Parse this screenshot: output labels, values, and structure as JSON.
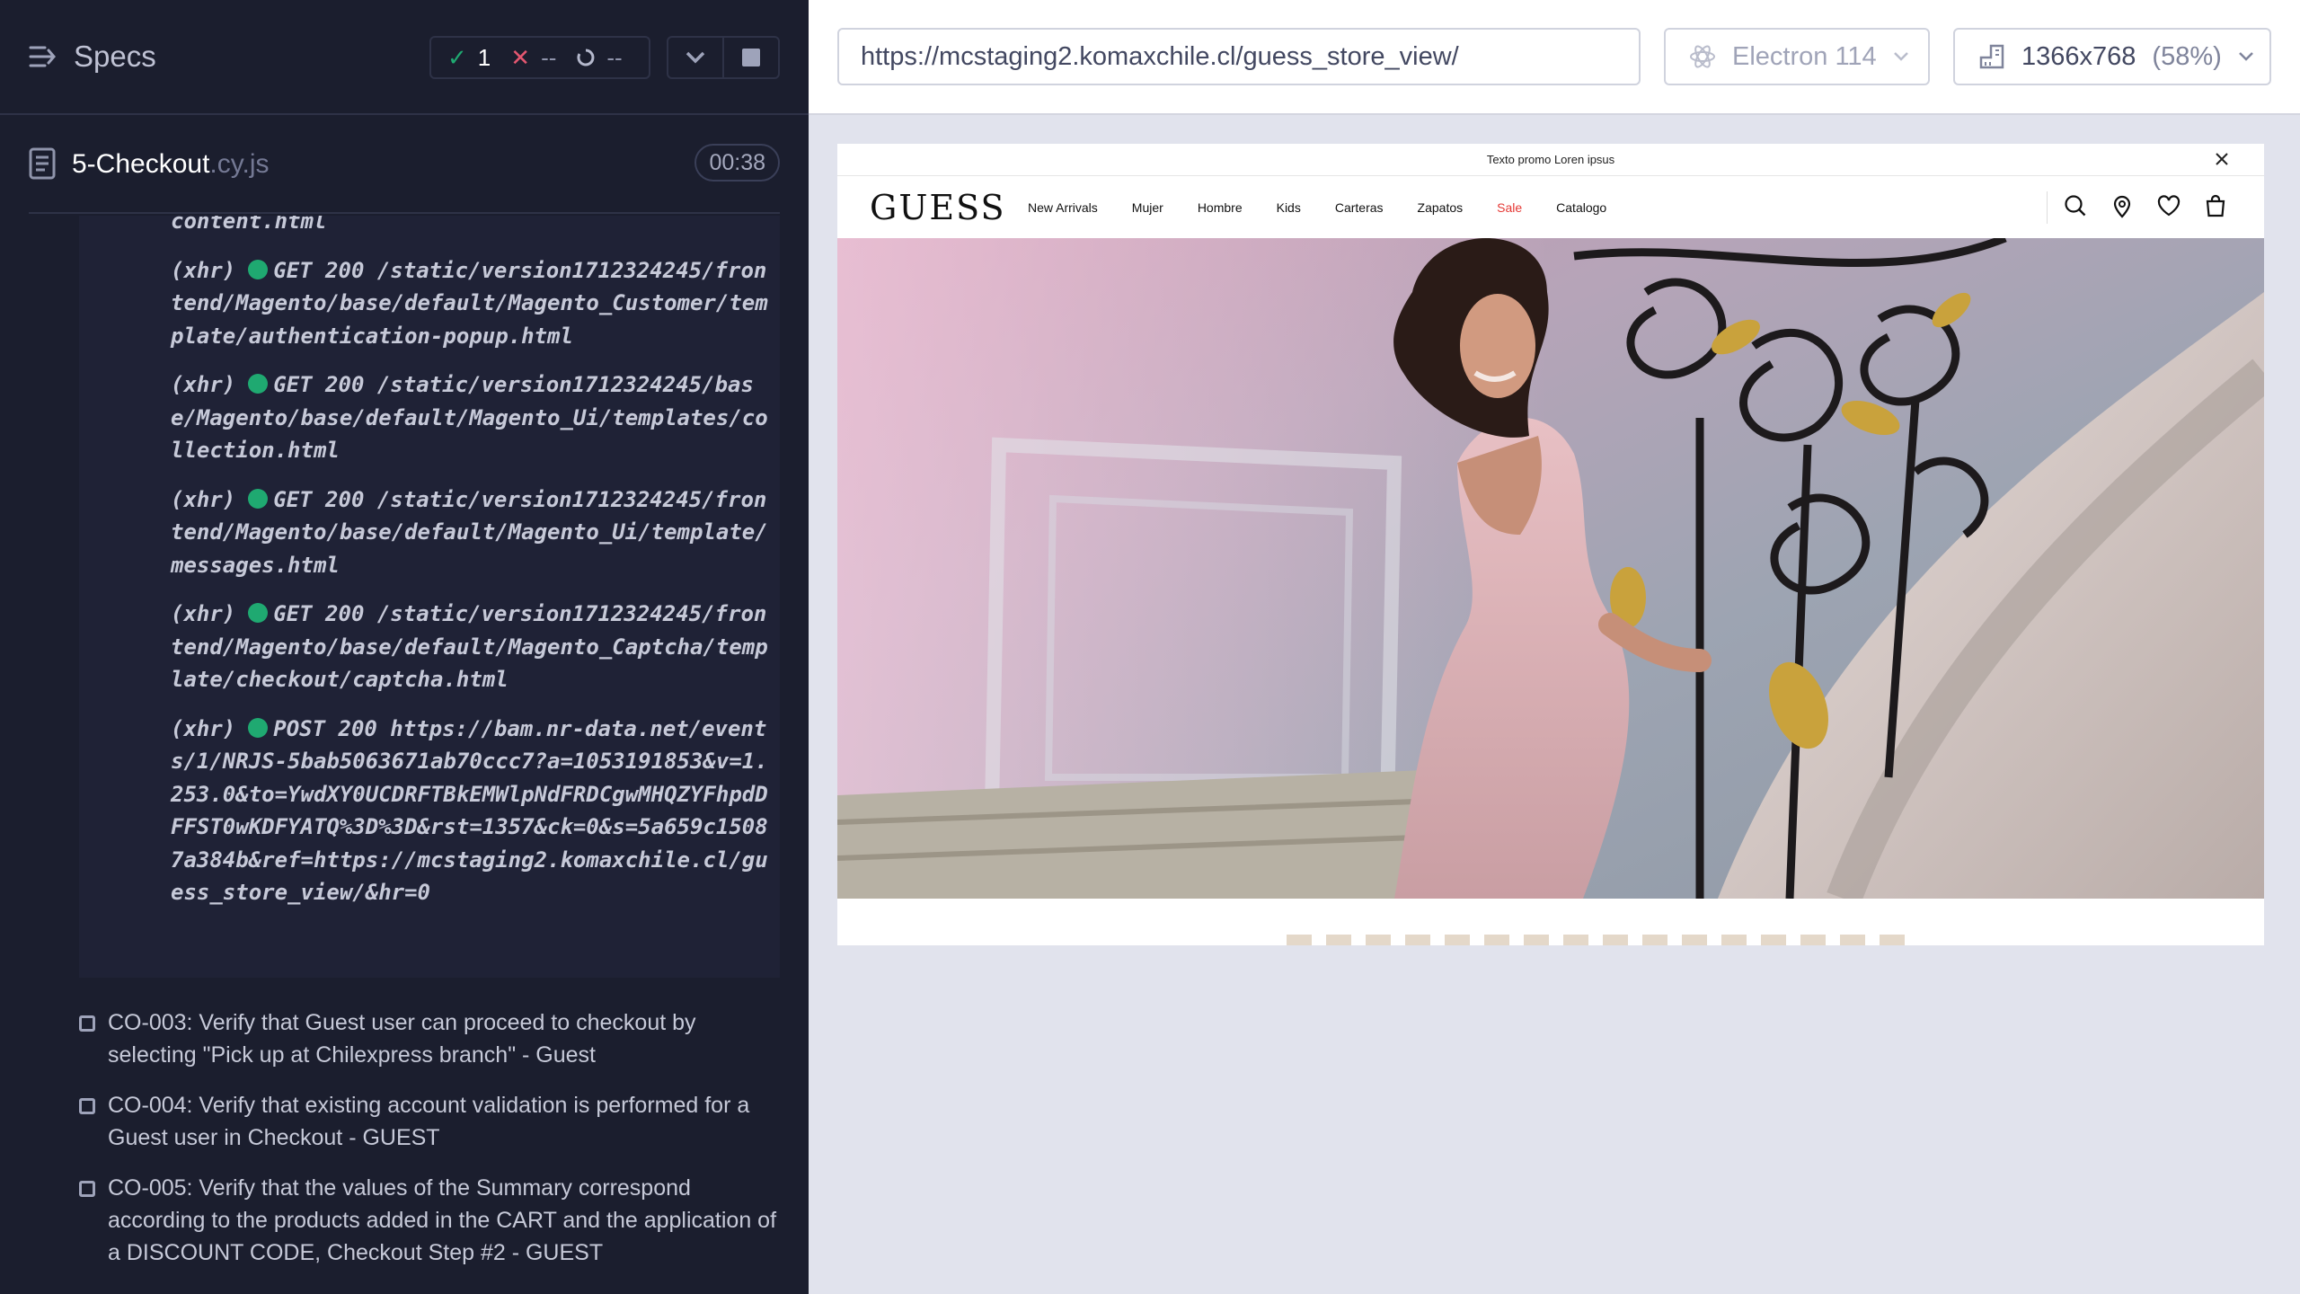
{
  "reporter": {
    "specs_label": "Specs",
    "stats": {
      "passed": "1",
      "failed": "--",
      "pending": "--"
    },
    "spec": {
      "name": "5-Checkout",
      "ext": ".cy.js",
      "duration": "00:38"
    },
    "log_partial_top": "content.html",
    "logs": [
      {
        "type": "(xhr)",
        "method": "GET 200",
        "url": "/static/version1712324245/frontend/Magento/base/default/Magento_Customer/template/authentication-popup.html"
      },
      {
        "type": "(xhr)",
        "method": "GET 200",
        "url": "/static/version1712324245/base/Magento/base/default/Magento_Ui/templates/collection.html"
      },
      {
        "type": "(xhr)",
        "method": "GET 200",
        "url": "/static/version1712324245/frontend/Magento/base/default/Magento_Ui/template/messages.html"
      },
      {
        "type": "(xhr)",
        "method": "GET 200",
        "url": "/static/version1712324245/frontend/Magento/base/default/Magento_Captcha/template/checkout/captcha.html"
      },
      {
        "type": "(xhr)",
        "method": "POST 200",
        "url": "https://bam.nr-data.net/events/1/NRJS-5bab5063671ab70ccc7?a=1053191853&v=1.253.0&to=YwdXY0UCDRFTBkEMWlpNdFRDCgwMHQZYFhpdDFFST0wKDFYATQ%3D%3D&rst=1357&ck=0&s=5a659c15087a384b&ref=https://mcstaging2.komaxchile.cl/guess_store_view/&hr=0"
      }
    ],
    "tests": [
      "CO-003: Verify that Guest user can proceed to checkout by selecting \"Pick up at Chilexpress branch\" - Guest",
      "CO-004: Verify that existing account validation is performed for a Guest user in Checkout - GUEST",
      "CO-005: Verify that the values of the Summary correspond according to the products added in the CART and the application of a DISCOUNT CODE, Checkout Step #2 - GUEST"
    ]
  },
  "aut": {
    "url": "https://mcstaging2.komaxchile.cl/guess_store_view/",
    "browser": "Electron 114",
    "viewport": "1366x768",
    "scale": "(58%)"
  },
  "site": {
    "promo": "Texto promo Loren ipsus",
    "logo": "GUESS",
    "menu": [
      "New Arrivals",
      "Mujer",
      "Hombre",
      "Kids",
      "Carteras",
      "Zapatos",
      "Sale",
      "Catalogo"
    ]
  },
  "colors": {
    "reporter_bg": "#1b1e2e",
    "pass": "#1fa971",
    "fail": "#e45770",
    "sale": "#e53935"
  }
}
